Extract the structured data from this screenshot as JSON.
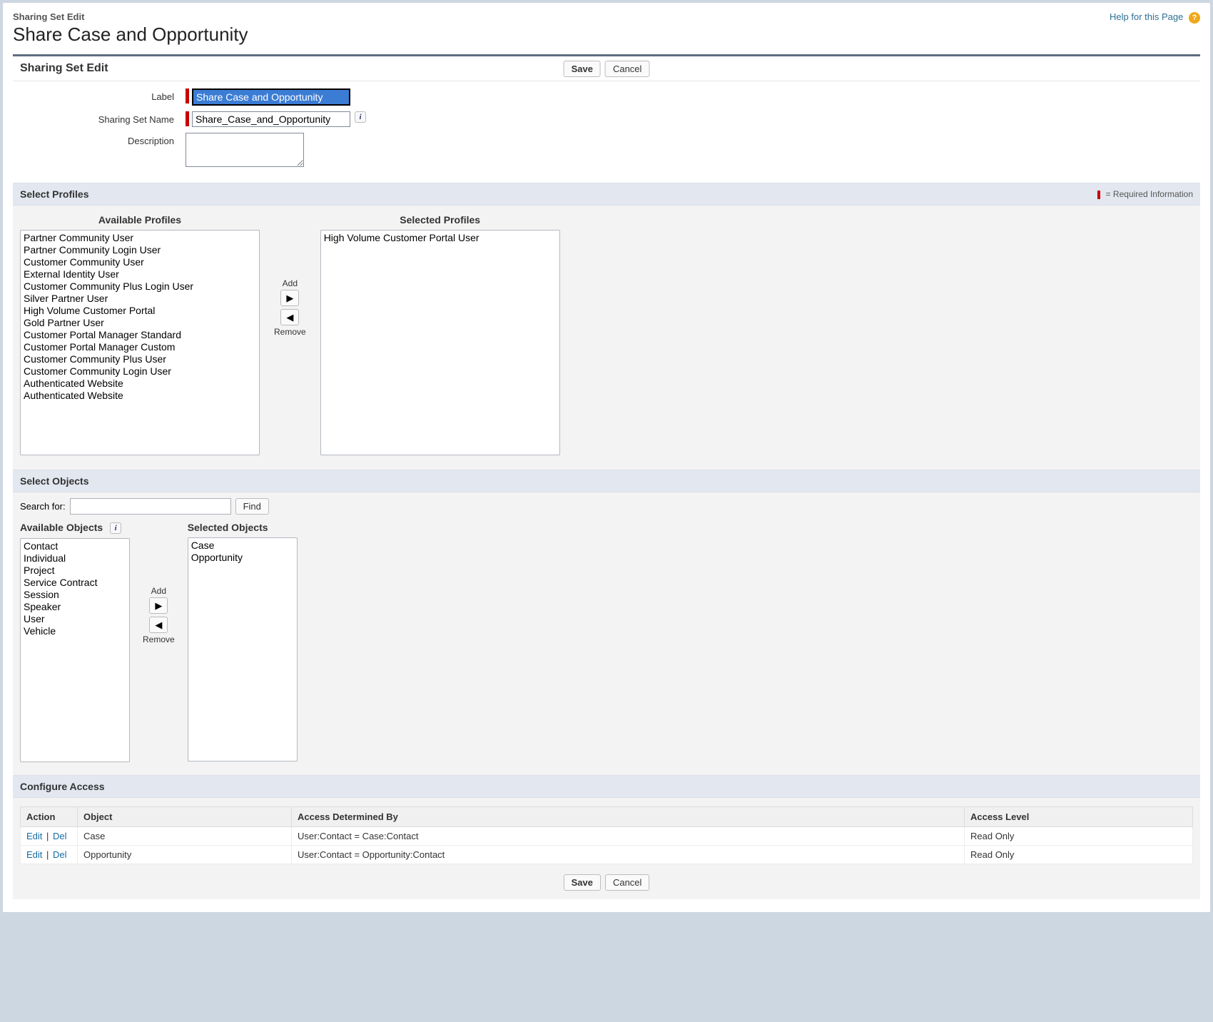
{
  "header": {
    "context": "Sharing Set Edit",
    "title": "Share Case and Opportunity",
    "help_link": "Help for this Page",
    "help_mark": "?"
  },
  "buttons": {
    "save": "Save",
    "cancel": "Cancel",
    "find": "Find",
    "add": "Add",
    "remove": "Remove"
  },
  "form": {
    "label_label": "Label",
    "label_value": "Share Case and Opportunity",
    "name_label": "Sharing Set Name",
    "name_value": "Share_Case_and_Opportunity",
    "desc_label": "Description",
    "desc_value": ""
  },
  "sections": {
    "edit": "Sharing Set Edit",
    "profiles": "Select Profiles",
    "objects": "Select Objects",
    "access": "Configure Access",
    "required_note": "= Required Information"
  },
  "profiles": {
    "available_heading": "Available Profiles",
    "selected_heading": "Selected Profiles",
    "available": [
      "Partner Community User",
      "Partner Community Login User",
      "Customer Community User",
      "External Identity User",
      "Customer Community Plus Login User",
      "Silver Partner User",
      "High Volume Customer Portal",
      "Gold Partner User",
      "Customer Portal Manager Standard",
      "Customer Portal Manager Custom",
      "Customer Community Plus User",
      "Customer Community Login User",
      "Authenticated Website",
      "Authenticated Website"
    ],
    "selected": [
      "High Volume Customer Portal User"
    ]
  },
  "objects": {
    "search_label": "Search  for:",
    "search_value": "",
    "available_heading": "Available Objects",
    "selected_heading": "Selected Objects",
    "available": [
      "Contact",
      "Individual",
      "Project",
      "Service Contract",
      "Session",
      "Speaker",
      "User",
      "Vehicle"
    ],
    "selected": [
      "Case",
      "Opportunity"
    ]
  },
  "access": {
    "columns": {
      "action": "Action",
      "object": "Object",
      "determined_by": "Access Determined By",
      "level": "Access Level"
    },
    "edit_link": "Edit",
    "del_link": "Del",
    "sep": "|",
    "rows": [
      {
        "object": "Case",
        "determined_by": "User:Contact = Case:Contact",
        "level": "Read Only"
      },
      {
        "object": "Opportunity",
        "determined_by": "User:Contact = Opportunity:Contact",
        "level": "Read Only"
      }
    ]
  }
}
